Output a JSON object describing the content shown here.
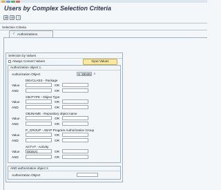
{
  "window": {
    "title": "Users by Complex Selection Criteria"
  },
  "toolbar": {
    "execute_icon": "execute-icon",
    "save_icon": "save-variant-icon",
    "info_icon": "info-icon"
  },
  "selection_criteria": {
    "label": "Selection Criteria",
    "tabs": [
      {
        "label": "Authorizations",
        "icon": "checkmark-icon"
      }
    ]
  },
  "selection_by_values": {
    "title": "Selection by Values",
    "always_convert_label": "Always Convert Values",
    "always_convert_checked": false,
    "input_values_button": "Input Values"
  },
  "auth_object_1": {
    "title": "Authorization object 1",
    "object_label": "Authorization Object",
    "object_value": "S_DEVELOP",
    "fields": [
      {
        "name": "DEVCLASS - Package",
        "value_label": "Value",
        "and_label": "AND",
        "or_label": "OR",
        "or2_label": "OR",
        "value": ""
      },
      {
        "name": "OBJTYPE - Object Type",
        "value_label": "Value",
        "and_label": "AND",
        "or_label": "OR",
        "or2_label": "OR",
        "value": ""
      },
      {
        "name": "OBJNAME - Repository object name",
        "value_label": "Value",
        "and_label": "AND",
        "or_label": "OR",
        "or2_label": "OR",
        "value": ""
      },
      {
        "name": "P_GROUP - ABAP Program Authorization Group",
        "value_label": "Value",
        "and_label": "AND",
        "or_label": "OR",
        "or2_label": "OR",
        "value": ""
      },
      {
        "name": "ACTVT - Activity",
        "value_label": "Value",
        "and_label": "AND",
        "or_label": "OR",
        "or2_label": "OR",
        "value": "DEBUG"
      }
    ]
  },
  "auth_object_2": {
    "title": "AND authorization object 2",
    "object_label": "Authorization Object",
    "object_value": ""
  }
}
